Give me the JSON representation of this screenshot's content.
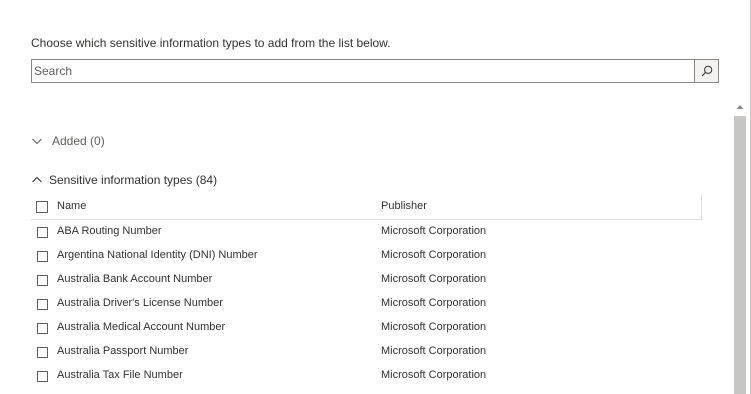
{
  "instruction": "Choose which sensitive information types to add from the list below.",
  "search": {
    "placeholder": "Search",
    "value": ""
  },
  "added_section": {
    "label": "Added (0)"
  },
  "types_section": {
    "label": "Sensitive information types (84)"
  },
  "table": {
    "columns": {
      "name": "Name",
      "publisher": "Publisher"
    },
    "rows": [
      {
        "name": "ABA Routing Number",
        "publisher": "Microsoft Corporation"
      },
      {
        "name": "Argentina National Identity (DNI) Number",
        "publisher": "Microsoft Corporation"
      },
      {
        "name": "Australia Bank Account Number",
        "publisher": "Microsoft Corporation"
      },
      {
        "name": "Australia Driver's License Number",
        "publisher": "Microsoft Corporation"
      },
      {
        "name": "Australia Medical Account Number",
        "publisher": "Microsoft Corporation"
      },
      {
        "name": "Australia Passport Number",
        "publisher": "Microsoft Corporation"
      },
      {
        "name": "Australia Tax File Number",
        "publisher": "Microsoft Corporation"
      }
    ]
  },
  "icons": {
    "search_button": "search-icon",
    "added_chevron": "chevron-down-icon",
    "types_chevron": "chevron-up-icon",
    "scroll_up": "scroll-up-arrow-icon"
  },
  "colors": {
    "border": "#8a8886",
    "scroll_thumb": "#c8c6c4",
    "text": "#323130",
    "muted_text": "#605e5c"
  }
}
